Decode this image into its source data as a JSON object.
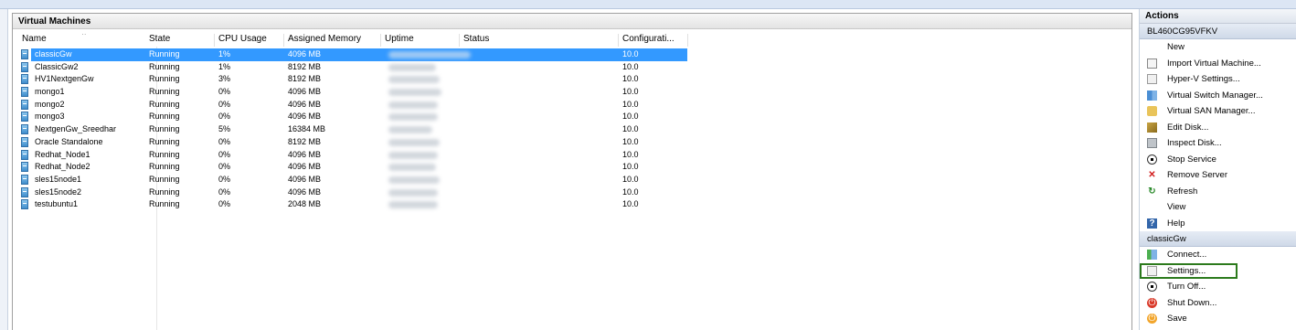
{
  "vm_panel": {
    "title": "Virtual Machines",
    "columns": [
      "Name",
      "State",
      "CPU Usage",
      "Assigned Memory",
      "Uptime",
      "Status",
      "Configurati..."
    ],
    "rows": [
      {
        "name": "classicGw",
        "state": "Running",
        "cpu": "1%",
        "memory": "4096 MB",
        "status": "",
        "config": "10.0",
        "selected": true
      },
      {
        "name": "ClassicGw2",
        "state": "Running",
        "cpu": "1%",
        "memory": "8192 MB",
        "status": "",
        "config": "10.0"
      },
      {
        "name": "HV1NextgenGw",
        "state": "Running",
        "cpu": "3%",
        "memory": "8192 MB",
        "status": "",
        "config": "10.0"
      },
      {
        "name": "mongo1",
        "state": "Running",
        "cpu": "0%",
        "memory": "4096 MB",
        "status": "",
        "config": "10.0"
      },
      {
        "name": "mongo2",
        "state": "Running",
        "cpu": "0%",
        "memory": "4096 MB",
        "status": "",
        "config": "10.0"
      },
      {
        "name": "mongo3",
        "state": "Running",
        "cpu": "0%",
        "memory": "4096 MB",
        "status": "",
        "config": "10.0"
      },
      {
        "name": "NextgenGw_Sreedhar",
        "state": "Running",
        "cpu": "5%",
        "memory": "16384 MB",
        "status": "",
        "config": "10.0"
      },
      {
        "name": "Oracle Standalone",
        "state": "Running",
        "cpu": "0%",
        "memory": "8192 MB",
        "status": "",
        "config": "10.0"
      },
      {
        "name": "Redhat_Node1",
        "state": "Running",
        "cpu": "0%",
        "memory": "4096 MB",
        "status": "",
        "config": "10.0"
      },
      {
        "name": "Redhat_Node2",
        "state": "Running",
        "cpu": "0%",
        "memory": "4096 MB",
        "status": "",
        "config": "10.0"
      },
      {
        "name": "sles15node1",
        "state": "Running",
        "cpu": "0%",
        "memory": "4096 MB",
        "status": "",
        "config": "10.0"
      },
      {
        "name": "sles15node2",
        "state": "Running",
        "cpu": "0%",
        "memory": "4096 MB",
        "status": "",
        "config": "10.0"
      },
      {
        "name": "testubuntu1",
        "state": "Running",
        "cpu": "0%",
        "memory": "2048 MB",
        "status": "",
        "config": "10.0"
      }
    ]
  },
  "actions": {
    "title": "Actions",
    "server_section": {
      "label": "BL460CG95VFKV",
      "items": [
        {
          "label": "New",
          "icon": "none"
        },
        {
          "label": "Import Virtual Machine...",
          "icon": "import-icon"
        },
        {
          "label": "Hyper-V Settings...",
          "icon": "settings-icon"
        },
        {
          "label": "Virtual Switch Manager...",
          "icon": "switch-icon"
        },
        {
          "label": "Virtual SAN Manager...",
          "icon": "san-icon"
        },
        {
          "label": "Edit Disk...",
          "icon": "edit-disk-icon"
        },
        {
          "label": "Inspect Disk...",
          "icon": "inspect-disk-icon"
        },
        {
          "label": "Stop Service",
          "icon": "stop-icon"
        },
        {
          "label": "Remove Server",
          "icon": "remove-icon"
        },
        {
          "label": "Refresh",
          "icon": "refresh-icon"
        },
        {
          "label": "View",
          "icon": "none"
        },
        {
          "label": "Help",
          "icon": "help-icon"
        }
      ]
    },
    "vm_section": {
      "label": "classicGw",
      "items": [
        {
          "label": "Connect...",
          "icon": "connect-icon"
        },
        {
          "label": "Settings...",
          "icon": "vm-settings-icon",
          "highlighted": true
        },
        {
          "label": "Turn Off...",
          "icon": "turn-off-icon"
        },
        {
          "label": "Shut Down...",
          "icon": "shut-down-icon"
        },
        {
          "label": "Save",
          "icon": "save-icon"
        }
      ]
    }
  },
  "colors": {
    "selection": "#3399ff",
    "highlight_outline": "#2c7a1c"
  }
}
